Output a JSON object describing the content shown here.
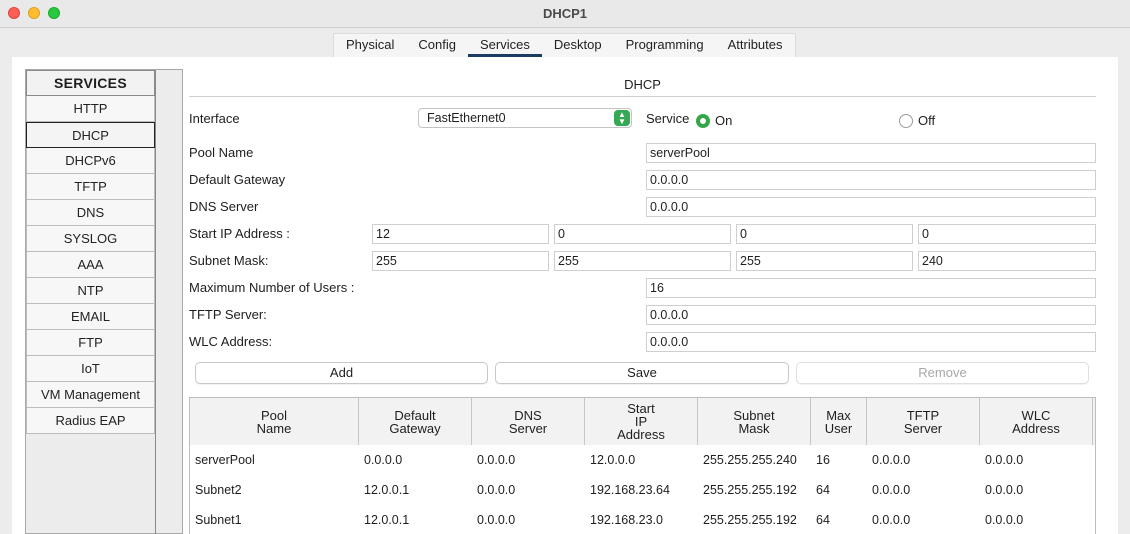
{
  "window": {
    "title": "DHCP1"
  },
  "tabs": [
    {
      "label": "Physical"
    },
    {
      "label": "Config"
    },
    {
      "label": "Services",
      "active": true
    },
    {
      "label": "Desktop"
    },
    {
      "label": "Programming"
    },
    {
      "label": "Attributes"
    }
  ],
  "services": {
    "header": "SERVICES",
    "items": [
      "HTTP",
      "DHCP",
      "DHCPv6",
      "TFTP",
      "DNS",
      "SYSLOG",
      "AAA",
      "NTP",
      "EMAIL",
      "FTP",
      "IoT",
      "VM Management",
      "Radius EAP"
    ],
    "selected": "DHCP"
  },
  "dhcp": {
    "title": "DHCP",
    "interface_label": "Interface",
    "interface_value": "FastEthernet0",
    "service_label": "Service",
    "on_label": "On",
    "off_label": "Off",
    "service_state": "On",
    "pool_name_label": "Pool Name",
    "pool_name": "serverPool",
    "default_gateway_label": "Default Gateway",
    "default_gateway": "0.0.0.0",
    "dns_server_label": "DNS Server",
    "dns_server": "0.0.0.0",
    "start_ip_label": "Start IP Address :",
    "start_ip": [
      "12",
      "0",
      "0",
      "0"
    ],
    "subnet_mask_label": "Subnet Mask:",
    "subnet_mask": [
      "255",
      "255",
      "255",
      "240"
    ],
    "max_users_label": "Maximum Number of Users :",
    "max_users": "16",
    "tftp_server_label": "TFTP Server:",
    "tftp_server": "0.0.0.0",
    "wlc_address_label": "WLC Address:",
    "wlc_address": "0.0.0.0",
    "buttons": {
      "add": "Add",
      "save": "Save",
      "remove": "Remove"
    }
  },
  "table": {
    "columns": [
      "Pool\nName",
      "Default\nGateway",
      "DNS\nServer",
      "Start\nIP\nAddress",
      "Subnet\nMask",
      "Max\nUser",
      "TFTP\nServer",
      "WLC\nAddress"
    ],
    "rows": [
      [
        "serverPool",
        "0.0.0.0",
        "0.0.0.0",
        "12.0.0.0",
        "255.255.255.240",
        "16",
        "0.0.0.0",
        "0.0.0.0"
      ],
      [
        "Subnet2",
        "12.0.0.1",
        "0.0.0.0",
        "192.168.23.64",
        "255.255.255.192",
        "64",
        "0.0.0.0",
        "0.0.0.0"
      ],
      [
        "Subnet1",
        "12.0.0.1",
        "0.0.0.0",
        "192.168.23.0",
        "255.255.255.192",
        "64",
        "0.0.0.0",
        "0.0.0.0"
      ]
    ]
  }
}
